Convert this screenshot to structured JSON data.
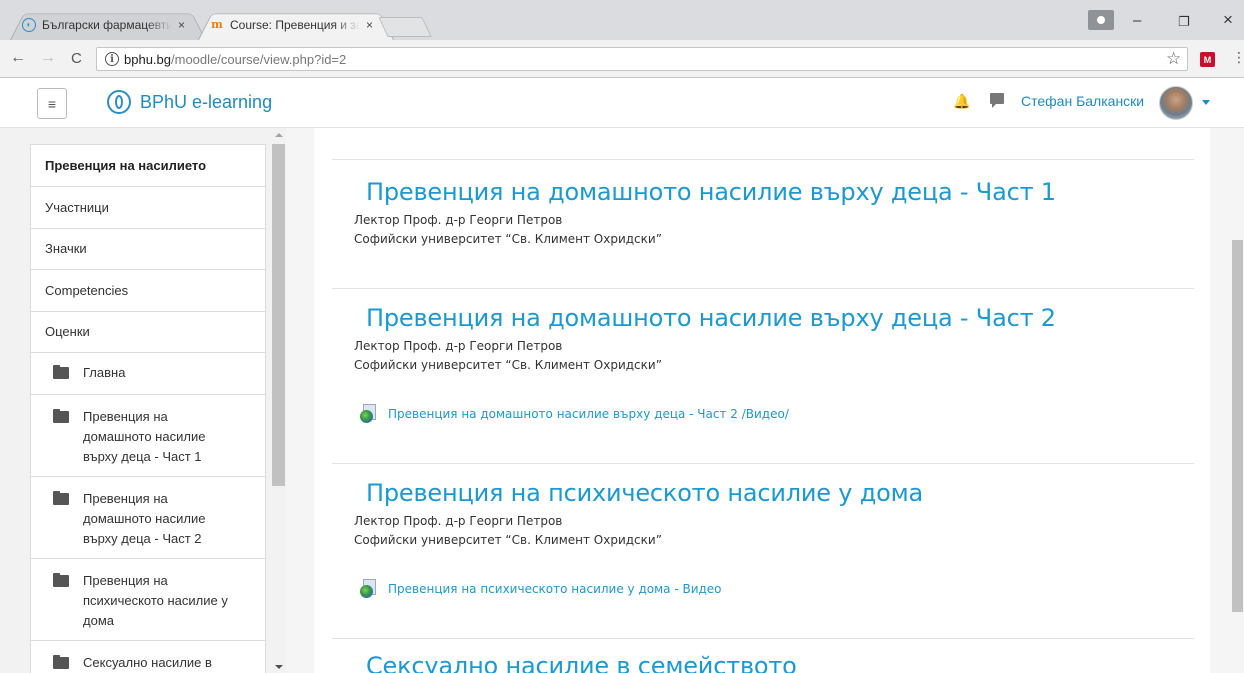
{
  "browser": {
    "tabs": [
      {
        "title": "Български фармацевти",
        "close": "×"
      },
      {
        "title": "Course: Превенция и за",
        "close": "×"
      }
    ],
    "address": {
      "host": "bphu.bg",
      "path": "/moodle/course/view.php?id=2"
    },
    "icons": {
      "back": "←",
      "forward": "→",
      "reload": "C",
      "info": "i",
      "star": "☆",
      "menu": "⋮",
      "minimize": "–",
      "restore": "❐",
      "close": "×"
    }
  },
  "header": {
    "site_name": "BPhU e-learning",
    "hamburger": "≡",
    "user_name": "Стефан Балкански",
    "icons": {
      "bell": "bell-icon",
      "chat": "chat-icon"
    }
  },
  "drawer": {
    "course_title": "Превенция на насилието",
    "links": [
      "Участници",
      "Значки",
      "Competencies",
      "Оценки"
    ],
    "sections": [
      "Главна",
      "Превенция на домашното насилие върху деца - Част 1",
      "Превенция на домашното насилие върху деца - Част 2",
      "Превенция на психическото насилие у дома",
      "Сексуално насилие в"
    ]
  },
  "course": {
    "sections": [
      {
        "title": "Превенция на домашното насилие върху деца - Част 1",
        "lecturer": "Лектор Проф. д-р Георги Петров",
        "university": "Софийски университет “Св. Климент Охридски”",
        "activity": ""
      },
      {
        "title": "Превенция на домашното насилие върху деца - Част 2",
        "lecturer": "Лектор Проф. д-р Георги Петров",
        "university": "Софийски университет “Св. Климент Охридски”",
        "activity": "Превенция на домашното насилие върху деца - Част 2 /Видео/"
      },
      {
        "title": "Превенция на психическото насилие у дома",
        "lecturer": "Лектор Проф. д-р Георги Петров",
        "university": "Софийски университет “Св. Климент Охридски”",
        "activity": "Превенция на психическото насилие у дома - Видео"
      },
      {
        "title": "Сексуално насилие в семейството",
        "lecturer": "",
        "university": "",
        "activity": ""
      }
    ]
  },
  "colors": {
    "link": "#1a9ad4",
    "brand": "#2a8fc6"
  }
}
